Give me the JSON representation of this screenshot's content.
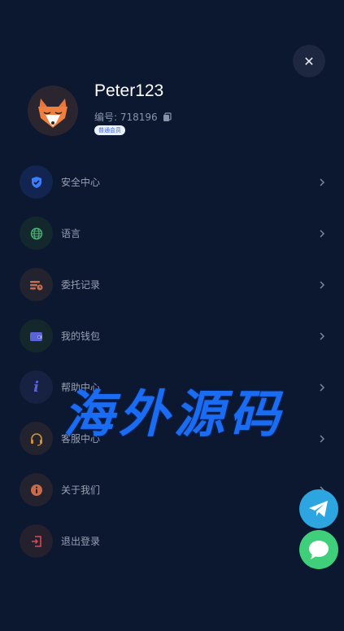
{
  "header": {
    "close_icon": "close-icon",
    "username": "Peter123",
    "uid_label": "编号: 718196",
    "level_badge": "普通会员",
    "copy_icon": "copy-icon"
  },
  "menu": [
    {
      "label": "安全中心",
      "icon": "shield-icon",
      "color": "#3b7cff"
    },
    {
      "label": "语言",
      "icon": "globe-icon",
      "color": "#4caf74"
    },
    {
      "label": "委托记录",
      "icon": "records-icon",
      "color": "#c96b4b"
    },
    {
      "label": "我的钱包",
      "icon": "wallet-icon",
      "color": "#5a63d8"
    },
    {
      "label": "帮助中心",
      "icon": "info-italic-icon",
      "color": "#5a63d8"
    },
    {
      "label": "客服中心",
      "icon": "headset-icon",
      "color": "#d0933a"
    },
    {
      "label": "关于我们",
      "icon": "info-circle-icon",
      "color": "#c96b4b"
    },
    {
      "label": "退出登录",
      "icon": "logout-icon",
      "color": "#d94a5a"
    }
  ],
  "watermark": "海外源码",
  "floating": {
    "telegram_icon": "telegram-icon",
    "chat_icon": "chat-bubble-icon"
  }
}
